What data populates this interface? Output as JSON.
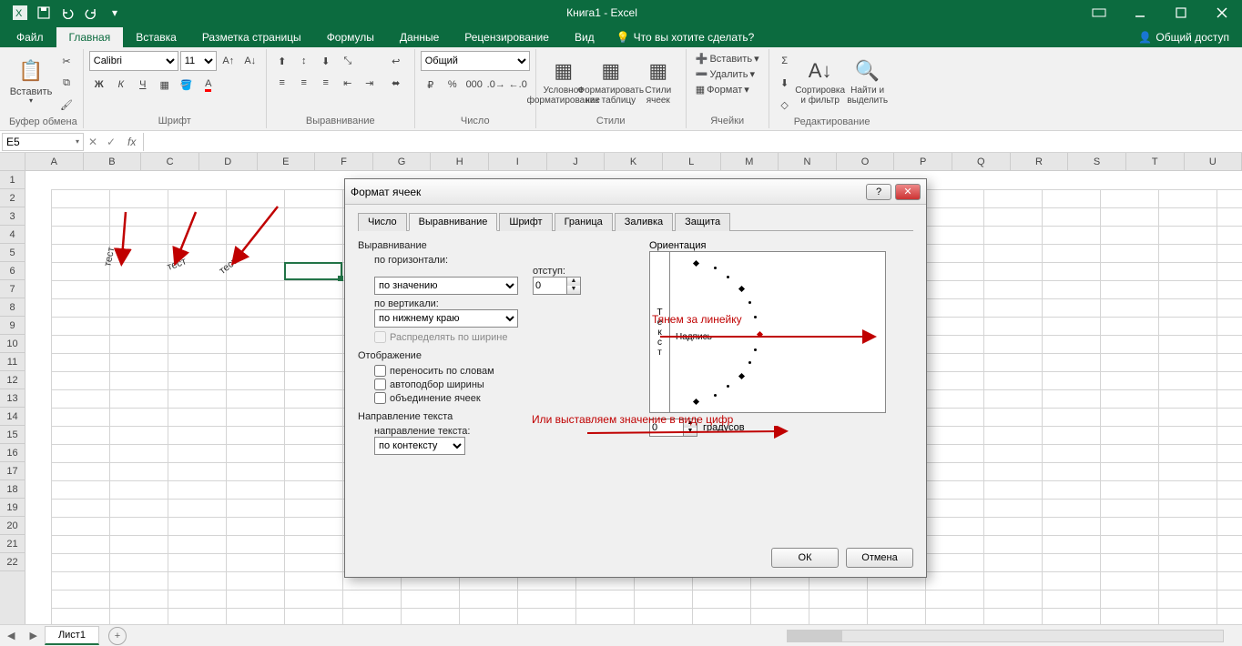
{
  "window": {
    "title": "Книга1 - Excel"
  },
  "qat": {
    "save": "💾",
    "undo": "↶",
    "redo": "↷"
  },
  "tabs": {
    "file": "Файл",
    "home": "Главная",
    "insert": "Вставка",
    "layout": "Разметка страницы",
    "formulas": "Формулы",
    "data": "Данные",
    "review": "Рецензирование",
    "view": "Вид",
    "tellme": "Что вы хотите сделать?",
    "share": "Общий доступ"
  },
  "ribbon": {
    "clipboard": {
      "label": "Буфер обмена",
      "paste": "Вставить"
    },
    "font": {
      "label": "Шрифт",
      "family": "Calibri",
      "size": "11",
      "bold": "Ж",
      "italic": "К",
      "underline": "Ч"
    },
    "align": {
      "label": "Выравнивание"
    },
    "number": {
      "label": "Число",
      "format": "Общий"
    },
    "styles": {
      "label": "Стили",
      "cond": "Условное форматирование",
      "table": "Форматировать как таблицу",
      "cell": "Стили ячеек"
    },
    "cells": {
      "label": "Ячейки",
      "insert": "Вставить",
      "delete": "Удалить",
      "format": "Формат"
    },
    "editing": {
      "label": "Редактирование",
      "sort": "Сортировка и фильтр",
      "find": "Найти и выделить"
    }
  },
  "namebox": "E5",
  "columns": [
    "A",
    "B",
    "C",
    "D",
    "E",
    "F",
    "G",
    "H",
    "I",
    "J",
    "K",
    "L",
    "M",
    "N",
    "O",
    "P",
    "Q",
    "R",
    "S",
    "T",
    "U"
  ],
  "rows": [
    "1",
    "2",
    "3",
    "4",
    "5",
    "6",
    "7",
    "8",
    "9",
    "10",
    "11",
    "12",
    "13",
    "14",
    "15",
    "16",
    "17",
    "18",
    "19",
    "20",
    "21",
    "22"
  ],
  "cells": {
    "b5": "тест",
    "c5": "тест",
    "d5": "тест"
  },
  "sheet": {
    "tab1": "Лист1"
  },
  "dialog": {
    "title": "Формат ячеек",
    "tabs": {
      "num": "Число",
      "align": "Выравнивание",
      "font": "Шрифт",
      "border": "Граница",
      "fill": "Заливка",
      "protect": "Защита"
    },
    "align_section": "Выравнивание",
    "horiz_label": "по горизонтали:",
    "horiz_val": "по значению",
    "vert_label": "по вертикали:",
    "vert_val": "по нижнему краю",
    "indent_label": "отступ:",
    "indent_val": "0",
    "distribute": "Распределять по ширине",
    "display_section": "Отображение",
    "wrap": "переносить по словам",
    "shrink": "автоподбор ширины",
    "merge": "объединение ячеек",
    "textdir_section": "Направление текста",
    "textdir_label": "направление текста:",
    "textdir_val": "по контексту",
    "orient_section": "Ориентация",
    "orient_vtext": "Текст",
    "orient_htext": "Надпись",
    "degrees_val": "0",
    "degrees_label": "градусов",
    "ok": "ОК",
    "cancel": "Отмена"
  },
  "annotations": {
    "ruler": "Тянем за линейку",
    "digits": "Или выставляем значение в виде цифр"
  }
}
